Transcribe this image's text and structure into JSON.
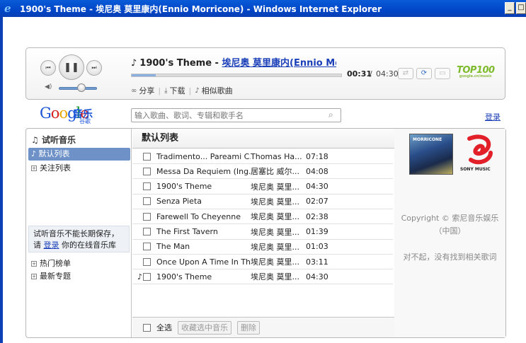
{
  "window": {
    "title": "1900's Theme - 埃尼奥 莫里康内(Ennio Morricone) - Windows Internet Explorer",
    "app_icon": "e",
    "minimize": "_",
    "maximize": "□"
  },
  "player": {
    "note": "♪",
    "song": "1900's Theme",
    "dash": " - ",
    "artist": "埃尼奥 莫里康内(Ennio Morricone)",
    "current_time": "00:31",
    "separator": "/",
    "total_time": "04:30",
    "progress_fraction": 0.115,
    "volume_fraction": 0.6,
    "prev_symbol": "⏮",
    "pause_symbol": "❚❚",
    "next_symbol": "⏭",
    "volume_symbol": "◀)",
    "share_label": "分享",
    "download_label": "下载",
    "similar_label": "相似歌曲",
    "brand": "TOP100",
    "brand_sub": "google.cn/music"
  },
  "header": {
    "logo_text": [
      "G",
      "o",
      "o",
      "g",
      "l",
      "e"
    ],
    "music_label": "音乐",
    "music_sub": "谷歌",
    "search_placeholder": "输入歌曲、歌词、专辑和歌手名",
    "login_label": "登录"
  },
  "sidebar": {
    "title": "试听音乐",
    "items": [
      {
        "label": "默认列表",
        "active": true
      },
      {
        "label": "关注列表"
      }
    ],
    "notice_line1": "试听音乐不能长期保存，",
    "notice_prefix": "请 ",
    "notice_link": "登录",
    "notice_suffix": " 你的在线音乐库",
    "bottom_items": [
      {
        "label": "热门榜单"
      },
      {
        "label": "最新专题"
      }
    ]
  },
  "playlist": {
    "title": "默认列表",
    "rows": [
      {
        "title": "Tradimento... Pareami C...",
        "artist": "Thomas Ha...",
        "time": "07:18",
        "playing": false
      },
      {
        "title": "Messa Da Requiem (Ing...",
        "artist": "居塞比 威尔...",
        "time": "04:08",
        "playing": false
      },
      {
        "title": "1900's Theme",
        "artist": "埃尼奥 莫里...",
        "time": "04:30",
        "playing": false
      },
      {
        "title": "Senza Pieta",
        "artist": "埃尼奥 莫里...",
        "time": "02:07",
        "playing": false
      },
      {
        "title": "Farewell To Cheyenne",
        "artist": "埃尼奥 莫里...",
        "time": "02:38",
        "playing": false
      },
      {
        "title": "The First Tavern",
        "artist": "埃尼奥 莫里...",
        "time": "01:39",
        "playing": false
      },
      {
        "title": "The Man",
        "artist": "埃尼奥 莫里...",
        "time": "01:03",
        "playing": false
      },
      {
        "title": "Once Upon A Time In Th...",
        "artist": "埃尼奥 莫里...",
        "time": "03:11",
        "playing": false
      },
      {
        "title": "1900's Theme",
        "artist": "埃尼奥 莫里...",
        "time": "04:30",
        "playing": true
      }
    ],
    "select_all": "全选",
    "collect_btn": "收藏选中音乐",
    "delete_btn": "删除"
  },
  "right": {
    "album_title": "MORRICONE",
    "sony_label": "SONY MUSIC",
    "copyright": "Copyright © 索尼音乐娱乐（中国）",
    "no_lyrics": "对不起，没有找到相关歌词",
    "sony_color": "#e2202a"
  }
}
